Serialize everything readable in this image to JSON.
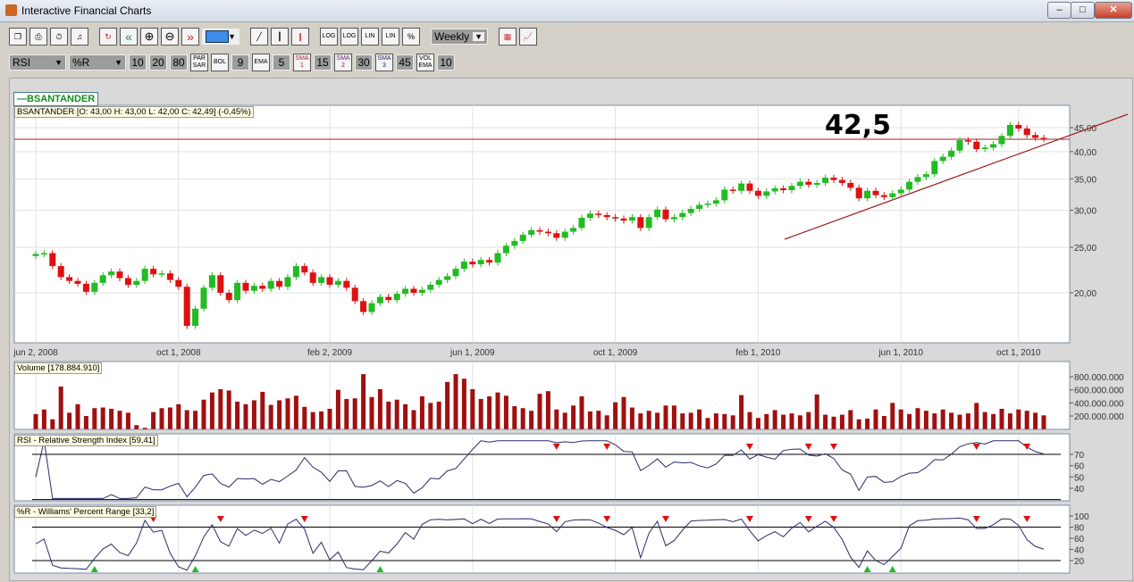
{
  "window": {
    "title": "Interactive Financial Charts",
    "min": "–",
    "max": "□",
    "close": "✕"
  },
  "toolbar1": {
    "icons": [
      "print-window-icon",
      "print-icon",
      "timer-icon",
      "sound-icon",
      "refresh-icon",
      "rewind-icon",
      "zoom-in-icon",
      "zoom-out-icon",
      "forward-icon"
    ],
    "glyphs": [
      "❐",
      "⎙",
      "⏱",
      "♫",
      "↻",
      "«",
      "⊕",
      "⊖",
      "»"
    ],
    "chart_types": [
      "╱",
      "┃",
      "❙"
    ],
    "scale_buttons": [
      "LOG",
      "LOG",
      "LIN",
      "LIN",
      "%"
    ],
    "period": "Weekly",
    "color_swatch": "#3c8ce8"
  },
  "toolbar2": {
    "indicator1": "RSI",
    "indicator2": "%R",
    "values": [
      "10",
      "20",
      "80"
    ],
    "parsar": "PAR SAR",
    "bol": "BOL",
    "bol_val": "9",
    "ema": "EMA",
    "ema_val": "5",
    "sma1": "SMA 1",
    "sma1_val": "15",
    "sma2": "SMA 2",
    "sma2_val": "30",
    "sma3": "SMA 3",
    "sma3_val": "45",
    "volema": "VOL EMA",
    "volema_val": "10"
  },
  "legend": "—BSANTANDER",
  "annotation": "42,5",
  "chart_data": {
    "type": "candlestick",
    "symbol_title": "BSANTANDER [O: 43,00  H: 43,00  L: 42,00  C: 42,49] (-0,45%)",
    "x_ticks": [
      "jun 2, 2008",
      "oct 1, 2008",
      "feb 2, 2009",
      "jun 1, 2009",
      "oct 1, 2009",
      "feb 1, 2010",
      "jun 1, 2010",
      "oct 1, 2010"
    ],
    "x_tick_index": [
      0,
      17,
      35,
      52,
      69,
      86,
      103,
      117
    ],
    "y_ticks": [
      "45,00",
      "40,00",
      "35,00",
      "30,00",
      "25,00",
      "20,00"
    ],
    "y_tick_values": [
      45,
      40,
      35,
      30,
      25,
      20
    ],
    "reference_line": 42.5,
    "close": [
      24.2,
      24.3,
      22.8,
      21.6,
      21.2,
      20.9,
      20.1,
      21.0,
      21.8,
      22.2,
      21.5,
      20.8,
      21.2,
      22.5,
      21.9,
      22.0,
      21.3,
      20.6,
      17.0,
      18.5,
      20.5,
      21.8,
      20.0,
      19.3,
      21.0,
      20.2,
      20.7,
      20.4,
      21.2,
      20.6,
      21.6,
      22.8,
      22.1,
      21.0,
      21.6,
      20.8,
      21.2,
      20.5,
      19.2,
      18.2,
      19.0,
      19.6,
      19.3,
      19.9,
      20.4,
      20.0,
      20.3,
      20.8,
      21.3,
      21.7,
      22.5,
      23.3,
      23.0,
      23.5,
      23.2,
      24.3,
      25.2,
      25.8,
      26.6,
      27.2,
      27.0,
      26.8,
      26.2,
      27.0,
      27.5,
      28.9,
      29.5,
      29.3,
      29.0,
      28.8,
      28.5,
      29.0,
      27.5,
      29.0,
      30.1,
      28.7,
      29.0,
      29.6,
      30.2,
      30.8,
      31.0,
      31.5,
      33.2,
      33.0,
      34.2,
      33.0,
      32.2,
      32.9,
      33.4,
      33.1,
      33.8,
      34.5,
      34.0,
      34.3,
      35.2,
      34.8,
      34.3,
      33.5,
      31.8,
      33.0,
      32.3,
      32.0,
      32.6,
      33.2,
      34.5,
      35.3,
      35.8,
      38.2,
      39.0,
      40.2,
      42.3,
      42.0,
      40.5,
      40.8,
      41.5,
      43.2,
      45.6,
      44.8,
      43.4,
      42.8,
      42.5
    ],
    "volume_title": "Volume [178.884.910]",
    "volume_ticks": [
      "800.000.000",
      "600.000.000",
      "400.000.000",
      "200.000.000"
    ],
    "volume_tick_values": [
      800,
      600,
      400,
      200
    ],
    "volume_millions": [
      230,
      300,
      150,
      650,
      250,
      380,
      200,
      320,
      330,
      310,
      280,
      250,
      60,
      20,
      260,
      320,
      330,
      380,
      290,
      280,
      450,
      560,
      610,
      590,
      420,
      380,
      440,
      570,
      370,
      440,
      470,
      510,
      340,
      260,
      270,
      310,
      600,
      460,
      470,
      840,
      490,
      610,
      420,
      450,
      380,
      290,
      500,
      400,
      420,
      720,
      840,
      770,
      610,
      460,
      500,
      560,
      510,
      350,
      320,
      280,
      540,
      580,
      300,
      250,
      360,
      500,
      270,
      280,
      210,
      410,
      490,
      330,
      240,
      280,
      250,
      360,
      360,
      240,
      250,
      300,
      170,
      240,
      230,
      210,
      520,
      260,
      170,
      230,
      290,
      220,
      240,
      210,
      260,
      530,
      220,
      190,
      220,
      290,
      150,
      160,
      300,
      200,
      400,
      300,
      230,
      320,
      280,
      240,
      300,
      250,
      220,
      240,
      400,
      260,
      230,
      310,
      240,
      300,
      280,
      250,
      210,
      270,
      220
    ],
    "rsi_title": "RSI - Relative Strength Index [59,41]",
    "rsi_ticks": [
      "70",
      "60",
      "50",
      "40"
    ],
    "rsi_tick_values": [
      70,
      60,
      50,
      40
    ],
    "rsi_levels": [
      70,
      30
    ],
    "rsi_period": 14,
    "wr_title": "%R - Williams' Percent Range [33,2]",
    "wr_ticks": [
      "100",
      "80",
      "60",
      "40",
      "20"
    ],
    "wr_tick_values": [
      100,
      80,
      60,
      40,
      20
    ],
    "wr_levels": [
      80,
      20
    ],
    "wr_period": 10,
    "colors": {
      "up": "#22bb22",
      "down": "#dd1111",
      "volume": "#a01010",
      "line": "#2a2a6a",
      "trend": "#a02020"
    }
  }
}
